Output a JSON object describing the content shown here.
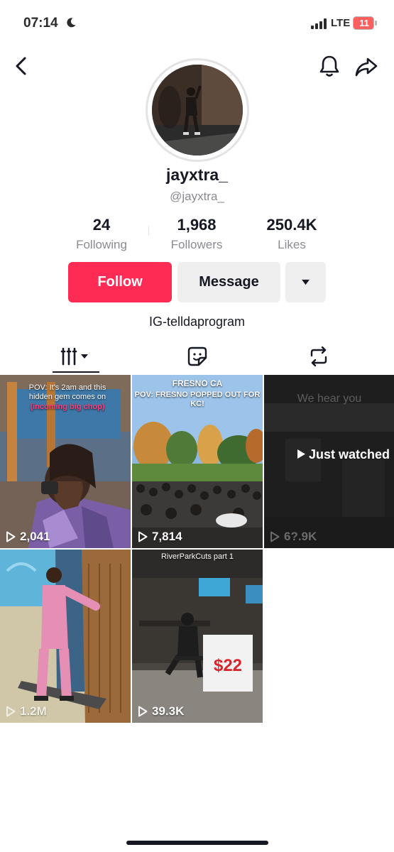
{
  "status_bar": {
    "time": "07:14",
    "network": "LTE",
    "battery": "11"
  },
  "profile": {
    "display_name": "jayxtra_",
    "handle": "@jayxtra_",
    "bio": "IG-telldaprogram"
  },
  "stats": [
    {
      "value": "24",
      "label": "Following"
    },
    {
      "value": "1,968",
      "label": "Followers"
    },
    {
      "value": "250.4K",
      "label": "Likes"
    }
  ],
  "actions": {
    "follow_label": "Follow",
    "message_label": "Message"
  },
  "tabs": [
    {
      "icon": "grid-icon",
      "active": true
    },
    {
      "icon": "sticker-icon",
      "active": false
    },
    {
      "icon": "repost-icon",
      "active": false
    }
  ],
  "videos": [
    {
      "views": "2,041",
      "caption_lines": [
        "POV: It's 2am and this",
        "hidden gem comes on"
      ],
      "caption_highlight": "(incoming big chop)"
    },
    {
      "views": "7,814",
      "caption_title": "FRESNO CA",
      "caption_sub": "POV: FRESNO POPPED OUT FOR KC!"
    },
    {
      "views": "6?.9K",
      "overlay_caption": "We hear you",
      "status": "Just watched"
    },
    {
      "views": "1.2M"
    },
    {
      "views": "39.3K",
      "caption_title": "RiverParkCuts part 1",
      "sign_price": "$22"
    }
  ],
  "colors": {
    "follow": "#fe2c55",
    "secondary_button": "#efefef",
    "muted_text": "#8a8b91",
    "primary_text": "#161823"
  }
}
